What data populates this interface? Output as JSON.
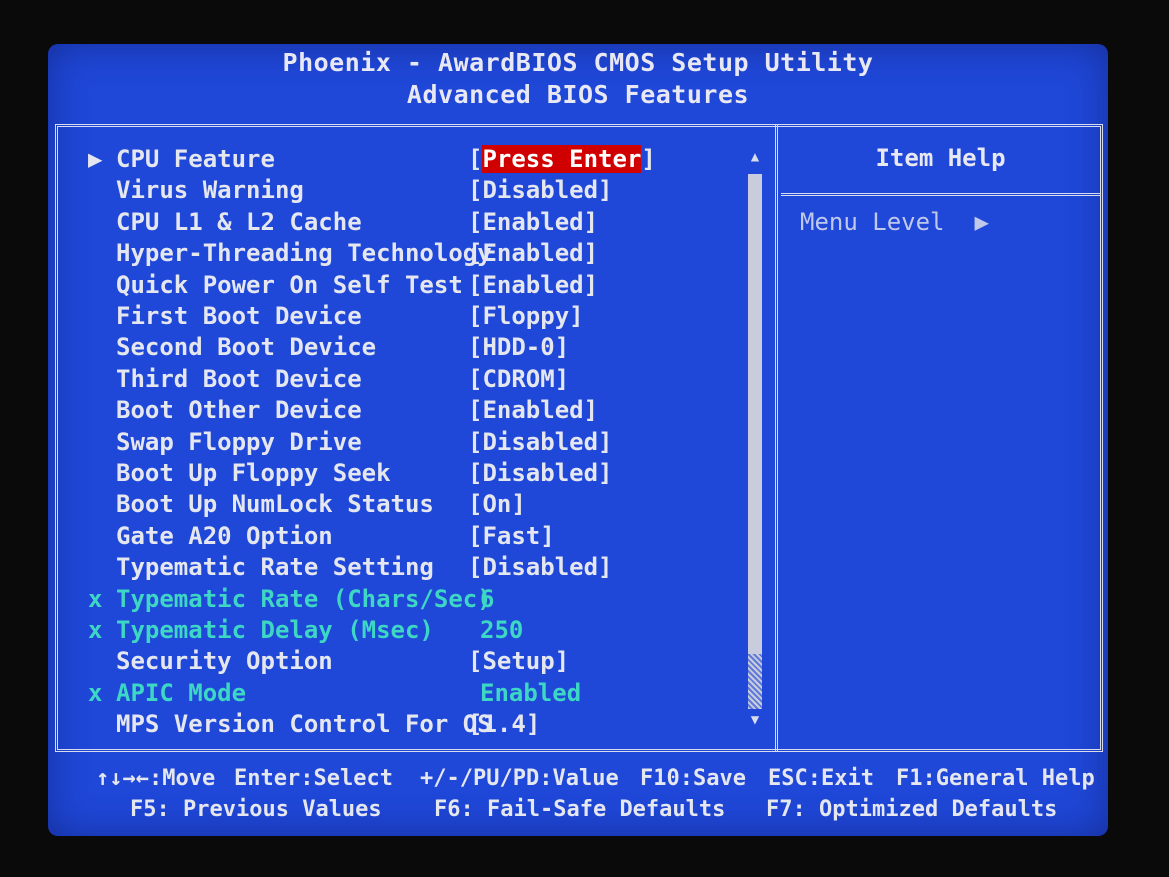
{
  "header": {
    "title": "Phoenix - AwardBIOS CMOS Setup Utility",
    "subtitle": "Advanced BIOS Features"
  },
  "settings": [
    {
      "marker": "▶",
      "label": "CPU Feature",
      "value_open": "[",
      "value": "Press Enter",
      "value_close": "]",
      "highlighted": true,
      "disabled": false
    },
    {
      "marker": "",
      "label": "Virus Warning",
      "value_open": "[",
      "value": "Disabled",
      "value_close": "]",
      "highlighted": false,
      "disabled": false
    },
    {
      "marker": "",
      "label": "CPU L1 & L2 Cache",
      "value_open": "[",
      "value": "Enabled",
      "value_close": "]",
      "highlighted": false,
      "disabled": false
    },
    {
      "marker": "",
      "label": "Hyper-Threading Technology",
      "value_open": "[",
      "value": "Enabled",
      "value_close": "]",
      "highlighted": false,
      "disabled": false
    },
    {
      "marker": "",
      "label": "Quick Power On Self Test",
      "value_open": "[",
      "value": "Enabled",
      "value_close": "]",
      "highlighted": false,
      "disabled": false
    },
    {
      "marker": "",
      "label": "First Boot Device",
      "value_open": "[",
      "value": "Floppy",
      "value_close": "]",
      "highlighted": false,
      "disabled": false
    },
    {
      "marker": "",
      "label": "Second Boot Device",
      "value_open": "[",
      "value": "HDD-0",
      "value_close": "]",
      "highlighted": false,
      "disabled": false
    },
    {
      "marker": "",
      "label": "Third Boot Device",
      "value_open": "[",
      "value": "CDROM",
      "value_close": "]",
      "highlighted": false,
      "disabled": false
    },
    {
      "marker": "",
      "label": "Boot Other Device",
      "value_open": "[",
      "value": "Enabled",
      "value_close": "]",
      "highlighted": false,
      "disabled": false
    },
    {
      "marker": "",
      "label": "Swap Floppy Drive",
      "value_open": "[",
      "value": "Disabled",
      "value_close": "]",
      "highlighted": false,
      "disabled": false
    },
    {
      "marker": "",
      "label": "Boot Up Floppy Seek",
      "value_open": "[",
      "value": "Disabled",
      "value_close": "]",
      "highlighted": false,
      "disabled": false
    },
    {
      "marker": "",
      "label": "Boot Up NumLock Status",
      "value_open": "[",
      "value": "On",
      "value_close": "]",
      "highlighted": false,
      "disabled": false
    },
    {
      "marker": "",
      "label": "Gate A20 Option",
      "value_open": "[",
      "value": "Fast",
      "value_close": "]",
      "highlighted": false,
      "disabled": false
    },
    {
      "marker": "",
      "label": "Typematic Rate Setting",
      "value_open": "[",
      "value": "Disabled",
      "value_close": "]",
      "highlighted": false,
      "disabled": false
    },
    {
      "marker": "x",
      "label": "Typematic Rate (Chars/Sec)",
      "value_open": "",
      "value": "6",
      "value_close": "",
      "highlighted": false,
      "disabled": true
    },
    {
      "marker": "x",
      "label": "Typematic Delay (Msec)",
      "value_open": "",
      "value": "250",
      "value_close": "",
      "highlighted": false,
      "disabled": true
    },
    {
      "marker": "",
      "label": "Security Option",
      "value_open": "[",
      "value": "Setup",
      "value_close": "]",
      "highlighted": false,
      "disabled": false
    },
    {
      "marker": "x",
      "label": "APIC Mode",
      "value_open": "",
      "value": "Enabled",
      "value_close": "",
      "highlighted": false,
      "disabled": true
    },
    {
      "marker": "",
      "label": "MPS Version Control For OS",
      "value_open": "[",
      "value": "1.4",
      "value_close": "]",
      "highlighted": false,
      "disabled": false
    }
  ],
  "scrollbar": {
    "up_icon": "triangle-up-icon",
    "down_icon": "triangle-down-icon"
  },
  "help_panel": {
    "title": "Item Help",
    "menu_level_label": "Menu Level",
    "menu_level_arrow": "▶"
  },
  "footer": {
    "line1": [
      {
        "key": "↑↓→←",
        "action": ":Move"
      },
      {
        "key": "Enter",
        "action": ":Select"
      },
      {
        "key": "+/-/PU/PD",
        "action": ":Value"
      },
      {
        "key": "F10",
        "action": ":Save"
      },
      {
        "key": "ESC",
        "action": ":Exit"
      },
      {
        "key": "F1",
        "action": ":General Help"
      }
    ],
    "line2": [
      {
        "key": "F5",
        "action": ": Previous Values"
      },
      {
        "key": "F6",
        "action": ": Fail-Safe Defaults"
      },
      {
        "key": "F7",
        "action": ": Optimized Defaults"
      }
    ]
  },
  "colors": {
    "background": "#1f47d8",
    "text": "#e4e6f0",
    "disabled_text": "#3ed6c4",
    "highlight": "#d00000"
  }
}
